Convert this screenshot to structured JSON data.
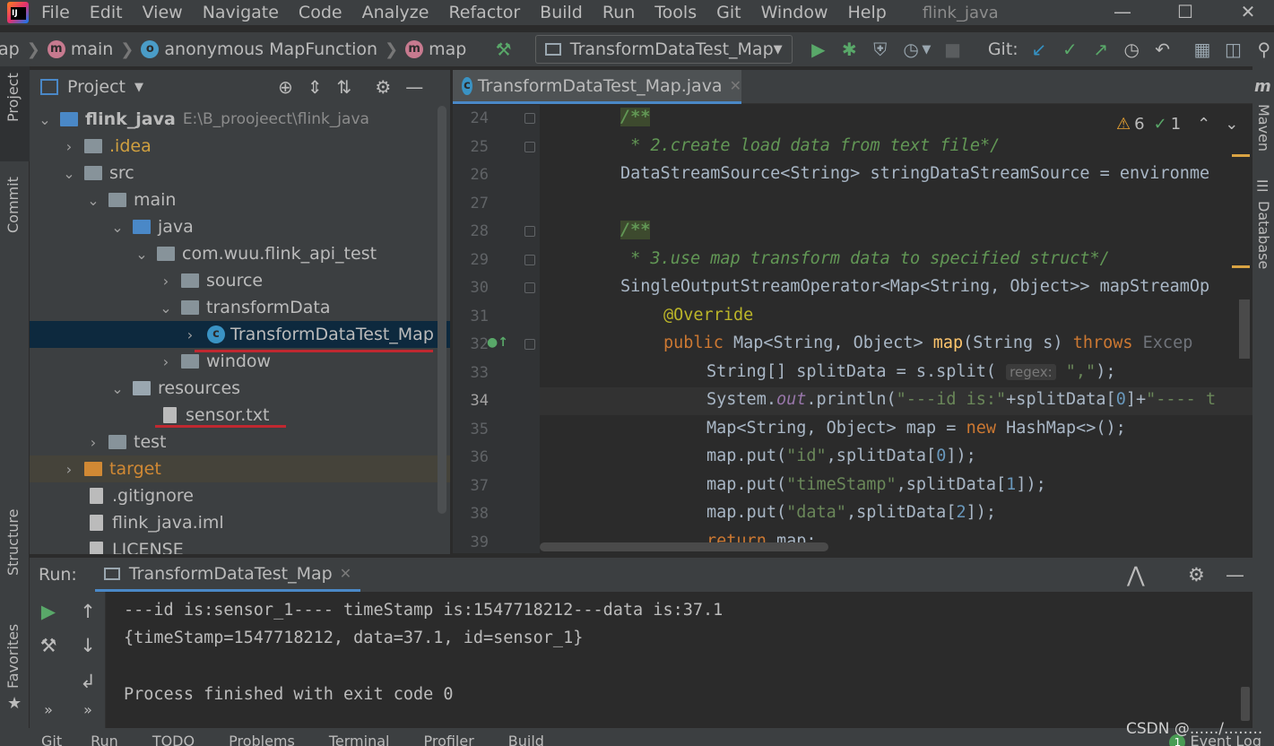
{
  "menubar": {
    "items": [
      "File",
      "Edit",
      "View",
      "Navigate",
      "Code",
      "Analyze",
      "Refactor",
      "Build",
      "Run",
      "Tools",
      "Git",
      "Window",
      "Help"
    ],
    "project_title": "flink_java"
  },
  "navbar": {
    "crumb_prefix": "ap",
    "crumb_main": "main",
    "crumb_class": "anonymous MapFunction",
    "crumb_method": "map",
    "run_config": "TransformDataTest_Map",
    "git_label": "Git:"
  },
  "left_strip": {
    "tabs": [
      "Project",
      "Commit",
      "Structure",
      "Favorites"
    ]
  },
  "right_strip": {
    "tabs": [
      "Maven",
      "Database"
    ]
  },
  "project": {
    "header": "Project",
    "root_name": "flink_java",
    "root_path": "E:\\B_proojeect\\flink_java",
    "items": [
      ".idea",
      "src",
      "main",
      "java",
      "com.wuu.flink_api_test",
      "source",
      "transformData",
      "TransformDataTest_Map",
      "window",
      "resources",
      "sensor.txt",
      "test",
      "target",
      ".gitignore",
      "flink_java.iml",
      "LICENSE"
    ]
  },
  "editor": {
    "tab": "TransformDataTest_Map.java",
    "warnings": "6",
    "weak_warnings": "1",
    "line_numbers": [
      "24",
      "25",
      "26",
      "27",
      "28",
      "29",
      "30",
      "31",
      "32",
      "33",
      "34",
      "35",
      "36",
      "37",
      "38",
      "39"
    ],
    "code": {
      "l24": "/**",
      "l25": " * 2.create load data from text file*/",
      "l26_type": "DataStreamSource<String> stringDataStreamSource = environme",
      "l28": "/**",
      "l29": " * 3.use map transform data to specified struct*/",
      "l30": "SingleOutputStreamOperator<Map<String, Object>> mapStreamOp",
      "l31": "@Override",
      "l32_kw": "public",
      "l32_mid": " Map<String, Object> ",
      "l32_fn": "map",
      "l32_args": "(String s) ",
      "l32_throws": "throws",
      "l32_exc": " Excep",
      "l33_a": "String[] splitData = s.split( ",
      "l33_hint": "regex:",
      "l33_s": " \",\"",
      "l33_b": ");",
      "l34_a": "System.",
      "l34_out": "out",
      "l34_b": ".println(",
      "l34_s1": "\"---id is:\"",
      "l34_c": "+splitData[",
      "l34_n": "0",
      "l34_d": "]+",
      "l34_s2": "\"---- t",
      "l35_a": "Map<String, Object> map = ",
      "l35_new": "new",
      "l35_b": " HashMap<>();",
      "l36_a": "map.put(",
      "l36_s": "\"id\"",
      "l36_b": ",splitData[",
      "l36_n": "0",
      "l36_c": "]);",
      "l37_a": "map.put(",
      "l37_s": "\"timeStamp\"",
      "l37_b": ",splitData[",
      "l37_n": "1",
      "l37_c": "]);",
      "l38_a": "map.put(",
      "l38_s": "\"data\"",
      "l38_b": ",splitData[",
      "l38_n": "2",
      "l38_c": "]);",
      "l39_kw": "return",
      "l39_b": " map;"
    }
  },
  "run": {
    "label": "Run:",
    "tab": "TransformDataTest_Map",
    "output": [
      "---id is:sensor_1---- timeStamp is:1547718212---data is:37.1",
      "{timeStamp=1547718212, data=37.1, id=sensor_1}",
      "",
      "Process finished with exit code 0"
    ]
  },
  "statusbar": {
    "items": [
      "Git",
      "Run",
      "TODO",
      "Problems",
      "Terminal",
      "Profiler",
      "Build"
    ],
    "event_log": "Event Log",
    "event_count": "1",
    "watermark": "CSDN @....../........"
  },
  "colors": {
    "background": "#2b2b2b",
    "panel": "#3c3f41",
    "selection": "#0d293e",
    "accent": "#4a88c7",
    "keyword": "#cc7832",
    "string": "#6a8759",
    "annotation_underline": "#c02830"
  }
}
